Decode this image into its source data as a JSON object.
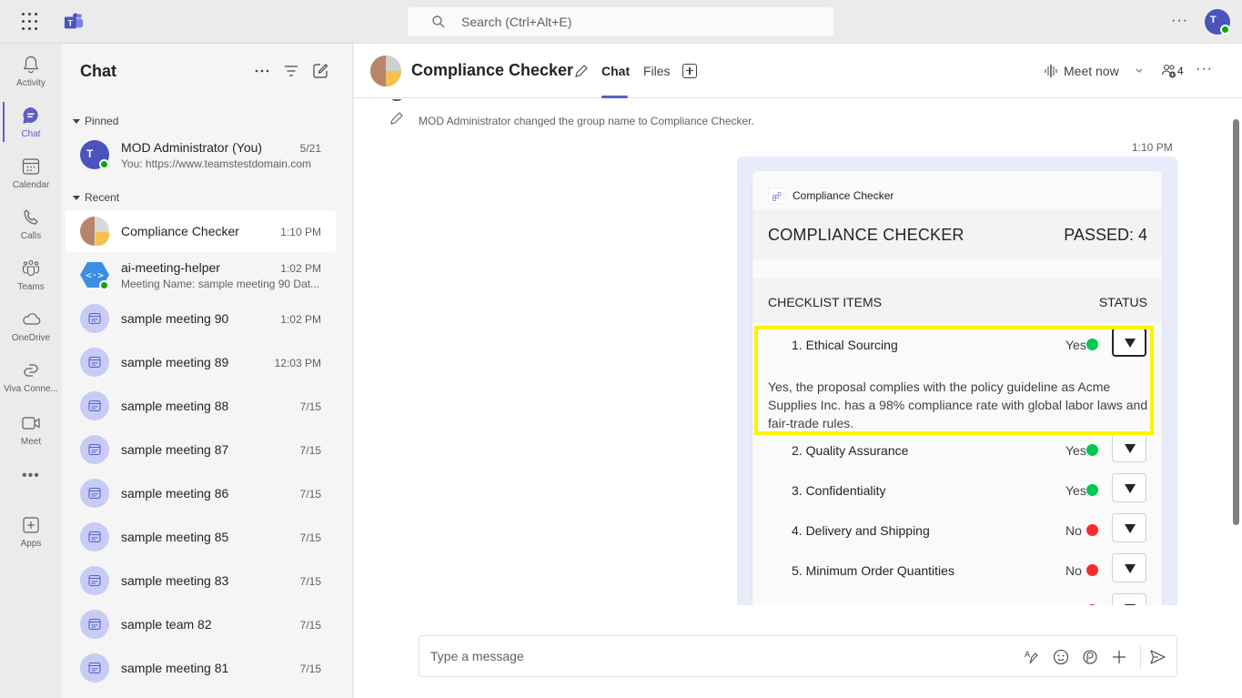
{
  "topbar": {
    "search_placeholder": "Search (Ctrl+Alt+E)",
    "more_label": "···",
    "avatar_initial": "T"
  },
  "rail": {
    "items": [
      {
        "label": "Activity",
        "icon": "bell-icon"
      },
      {
        "label": "Chat",
        "icon": "chat-icon",
        "active": true
      },
      {
        "label": "Calendar",
        "icon": "calendar-icon"
      },
      {
        "label": "Calls",
        "icon": "phone-icon"
      },
      {
        "label": "Teams",
        "icon": "teams-icon"
      },
      {
        "label": "OneDrive",
        "icon": "cloud-icon"
      },
      {
        "label": "Viva Conne...",
        "icon": "viva-connections-icon"
      },
      {
        "label": "Meet",
        "icon": "video-icon"
      },
      {
        "label": "Apps",
        "icon": "add-app-icon"
      }
    ],
    "more_label": "•••"
  },
  "chatlist": {
    "title": "Chat",
    "sections": {
      "pinned": "Pinned",
      "recent": "Recent"
    },
    "pinned": [
      {
        "name": "MOD Administrator (You)",
        "time": "5/21",
        "preview": "You: https://www.teamstestdomain.com"
      }
    ],
    "recent": [
      {
        "name": "Compliance Checker",
        "time": "1:10 PM",
        "selected": true
      },
      {
        "name": "ai-meeting-helper",
        "time": "1:02 PM",
        "preview": "Meeting Name: sample meeting 90 Dat..."
      },
      {
        "name": "sample meeting 90",
        "time": "1:02 PM"
      },
      {
        "name": "sample meeting 89",
        "time": "12:03 PM"
      },
      {
        "name": "sample meeting 88",
        "time": "7/15"
      },
      {
        "name": "sample meeting 87",
        "time": "7/15"
      },
      {
        "name": "sample meeting 86",
        "time": "7/15"
      },
      {
        "name": "sample meeting 85",
        "time": "7/15"
      },
      {
        "name": "sample meeting 83",
        "time": "7/15"
      },
      {
        "name": "sample team 82",
        "time": "7/15"
      },
      {
        "name": "sample meeting 81",
        "time": "7/15"
      }
    ]
  },
  "header": {
    "title": "Compliance Checker",
    "tabs": [
      {
        "label": "Chat",
        "active": true
      },
      {
        "label": "Files"
      }
    ],
    "meet_now": "Meet now",
    "participant_count": "4",
    "more_label": "···"
  },
  "messages": {
    "system_message": "MOD Administrator changed the group name to Compliance Checker.",
    "card_time": "1:10 PM",
    "card": {
      "app_name": "Compliance Checker",
      "title": "COMPLIANCE CHECKER",
      "passed": "PASSED: 4",
      "col_items": "CHECKLIST ITEMS",
      "col_status": "STATUS",
      "items": [
        {
          "label": "1. Ethical Sourcing",
          "status": "Yes",
          "color": "#00c853",
          "expanded": true,
          "detail": "Yes, the proposal complies with the policy guideline as Acme Supplies Inc. has a 98% compliance rate with global labor laws and fair-trade rules."
        },
        {
          "label": "2. Quality Assurance",
          "status": "Yes",
          "color": "#00c853"
        },
        {
          "label": "3. Confidentiality",
          "status": "Yes",
          "color": "#00c853"
        },
        {
          "label": "4. Delivery and Shipping",
          "status": "No",
          "color": "#f52c2c"
        },
        {
          "label": "5. Minimum Order Quantities",
          "status": "No",
          "color": "#f52c2c"
        },
        {
          "label": "",
          "status": "",
          "color": "#f52c2c"
        }
      ]
    }
  },
  "composer": {
    "placeholder": "Type a message"
  },
  "colors": {
    "brand": "#5b5fc7",
    "highlight": "#fff200",
    "yes": "#00c853",
    "no": "#f52c2c"
  }
}
